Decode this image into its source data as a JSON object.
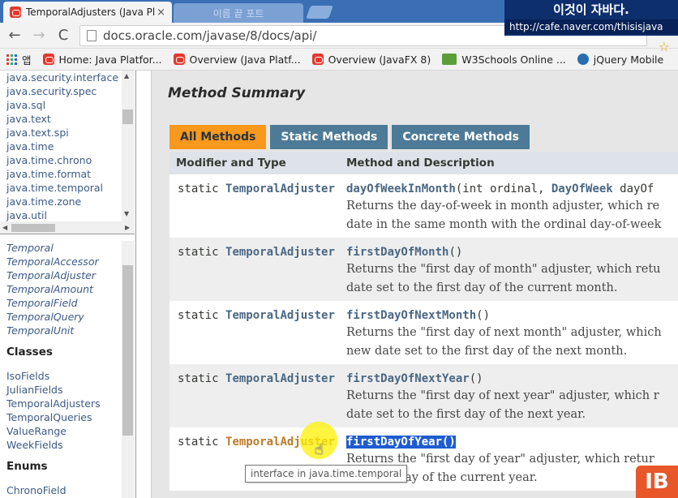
{
  "browser": {
    "active_tab_title": "TemporalAdjusters (Java Pl",
    "tab_close": "×",
    "second_tab_title": "이름 끝 포트",
    "url": "docs.oracle.com/javase/8/docs/api/",
    "back": "←",
    "forward": "→",
    "reload": "C",
    "star": "☆"
  },
  "watermark": {
    "line1": "이것이 자바다.",
    "line2": "http://cafe.naver.com/thisisjava"
  },
  "bookmarks": {
    "apps_label": "앱",
    "items": [
      "Home: Java Platfor...",
      "Overview (Java Platf...",
      "Overview (JavaFX 8)",
      "W3Schools Online ...",
      "jQuery Mobile"
    ]
  },
  "packages": [
    "java.security.interface",
    "java.security.spec",
    "java.sql",
    "java.text",
    "java.text.spi",
    "java.time",
    "java.time.chrono",
    "java.time.format",
    "java.time.temporal",
    "java.time.zone",
    "java.util"
  ],
  "class_pane": {
    "interfaces": [
      "Temporal",
      "TemporalAccessor",
      "TemporalAdjuster",
      "TemporalAmount",
      "TemporalField",
      "TemporalQuery",
      "TemporalUnit"
    ],
    "classes_header": "Classes",
    "classes": [
      "IsoFields",
      "JulianFields",
      "TemporalAdjusters",
      "TemporalQueries",
      "ValueRange",
      "WeekFields"
    ],
    "enums_header": "Enums",
    "enums": [
      "ChronoField"
    ]
  },
  "main": {
    "section_title": "Method Summary",
    "tabs": [
      "All Methods",
      "Static Methods",
      "Concrete Methods"
    ],
    "col_modifier": "Modifier and Type",
    "col_method": "Method and Description",
    "rows": [
      {
        "modifier": "static",
        "type": "TemporalAdjuster",
        "name": "dayOfWeekInMonth",
        "params_open": "(int ordinal, ",
        "param_type": "DayOfWeek",
        "params_rest": " dayOf",
        "desc1": "Returns the day-of-week in month adjuster, which re",
        "desc2": "date in the same month with the ordinal day-of-week"
      },
      {
        "modifier": "static",
        "type": "TemporalAdjuster",
        "name": "firstDayOfMonth",
        "params_open": "()",
        "param_type": "",
        "params_rest": "",
        "desc1": "Returns the \"first day of month\" adjuster, which retu",
        "desc2": "date set to the first day of the current month."
      },
      {
        "modifier": "static",
        "type": "TemporalAdjuster",
        "name": "firstDayOfNextMonth",
        "params_open": "()",
        "param_type": "",
        "params_rest": "",
        "desc1": "Returns the \"first day of next month\" adjuster, which",
        "desc2": "new date set to the first day of the next month."
      },
      {
        "modifier": "static",
        "type": "TemporalAdjuster",
        "name": "firstDayOfNextYear",
        "params_open": "()",
        "param_type": "",
        "params_rest": "",
        "desc1": "Returns the \"first day of next year\" adjuster, which r",
        "desc2": "date set to the first day of the next year."
      },
      {
        "modifier": "static",
        "type": "TemporalAdjuster",
        "name": "firstDayOfYear()",
        "params_open": "",
        "param_type": "",
        "params_rest": "",
        "desc1": "Returns the \"first day of year\" adjuster, which retur",
        "desc2": "the first day of the current year."
      }
    ],
    "tooltip": "interface in java.time.temporal"
  },
  "colors": {
    "active_tab": "#f8981d",
    "inactive_tab": "#4d7a97",
    "selection": "#1e5ccf",
    "link": "#4a6782"
  },
  "icons": [
    "page-favicon",
    "back-arrow-icon",
    "forward-arrow-icon",
    "reload-icon",
    "page-icon",
    "star-icon",
    "apps-icon",
    "hand-cursor-icon",
    "logo-icon"
  ],
  "logo_text": "IB"
}
